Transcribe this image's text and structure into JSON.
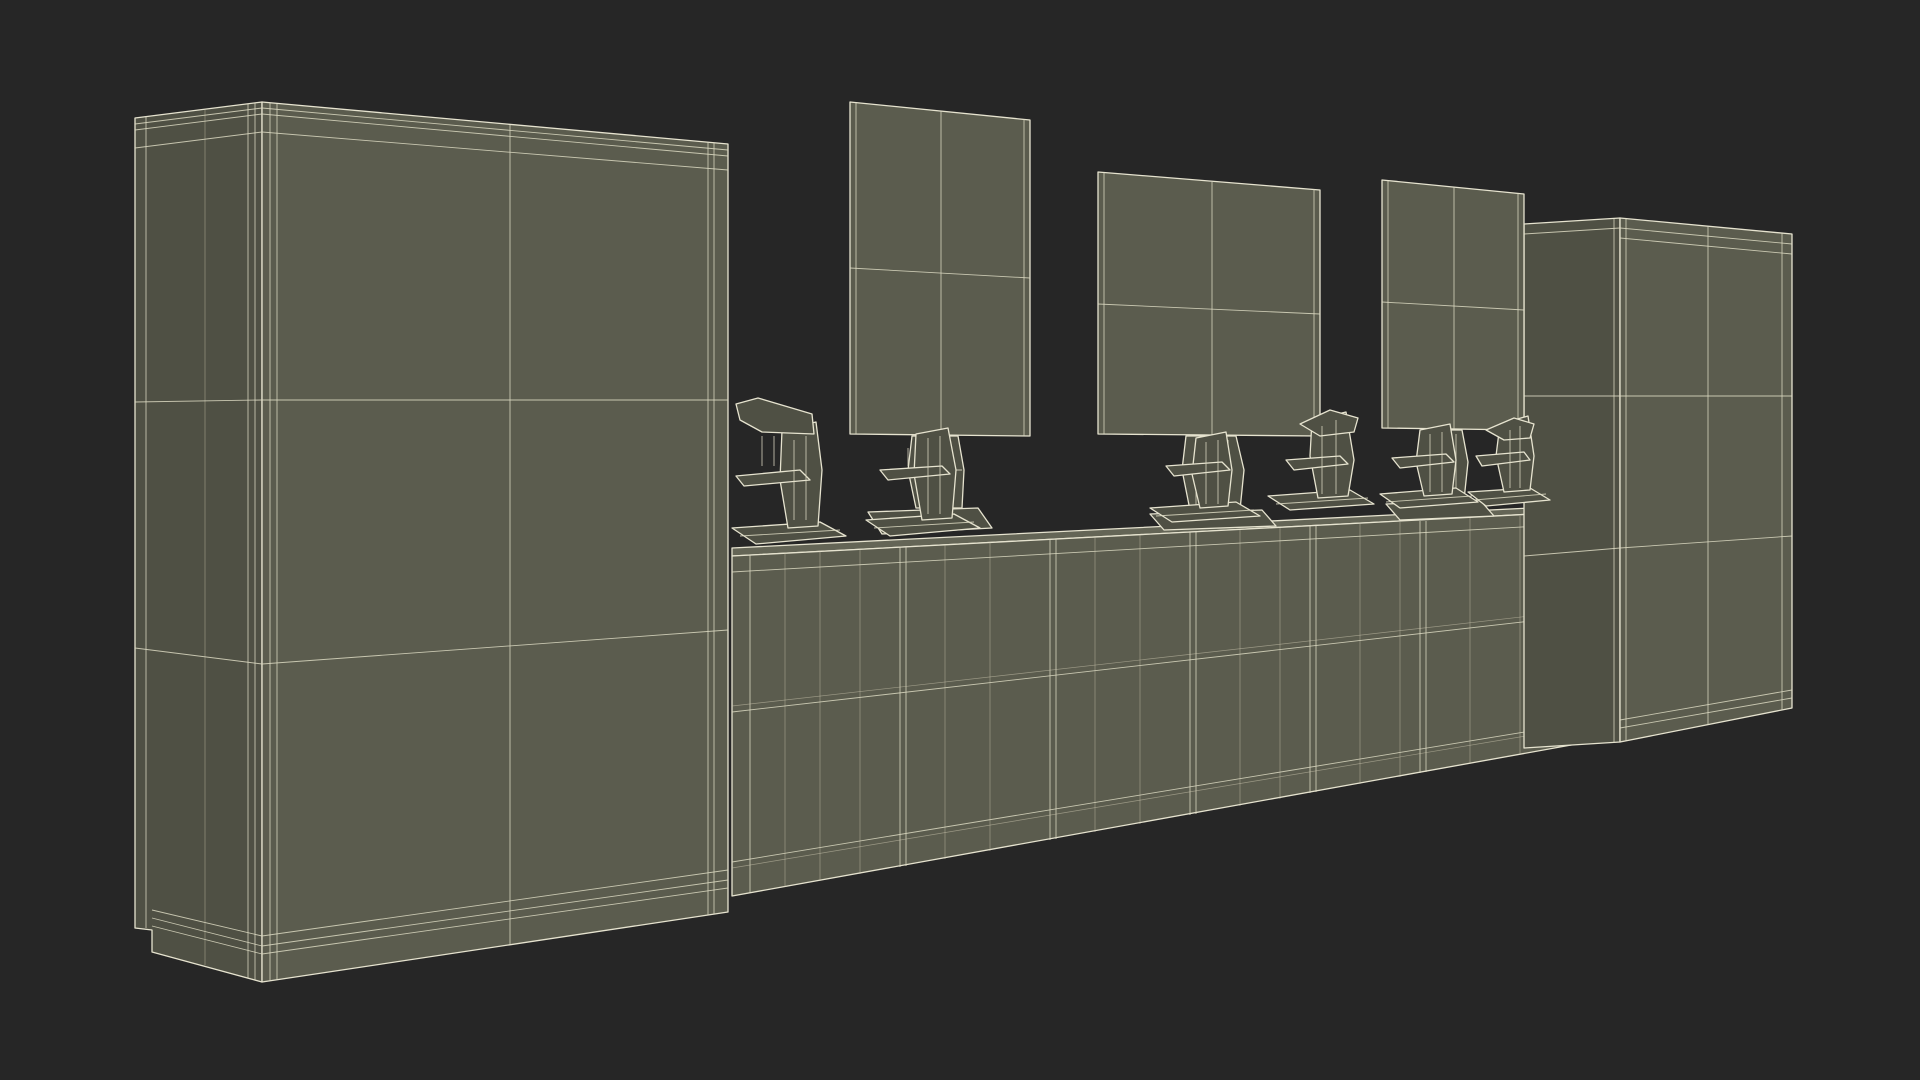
{
  "scene": {
    "background_color": "#262626",
    "wire_color": "#e6e3cf",
    "surface_color": "#5b5c4e",
    "objects": [
      {
        "name": "tall-cabinet-left"
      },
      {
        "name": "tall-cabinet-right"
      },
      {
        "name": "lab-bench"
      },
      {
        "name": "monitor",
        "count": 3
      },
      {
        "name": "microscope",
        "count": 6
      }
    ]
  }
}
